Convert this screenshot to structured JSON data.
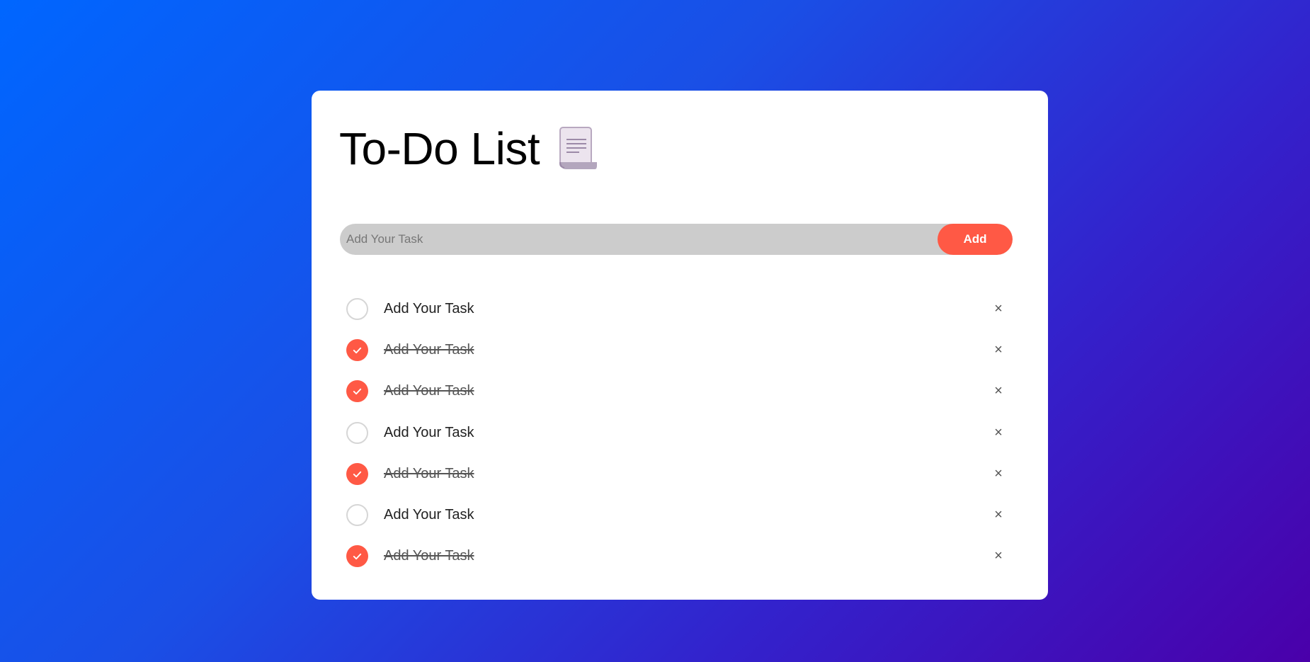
{
  "app": {
    "title": "To-Do List",
    "title_icon": "scroll-document-icon"
  },
  "input": {
    "placeholder": "Add Your Task",
    "value": ""
  },
  "add_button": {
    "label": "Add"
  },
  "colors": {
    "accent": "#ff5945",
    "input_background": "#cccccc",
    "card": "#ffffff"
  },
  "tasks": [
    {
      "text": "Add Your Task",
      "checked": false
    },
    {
      "text": "Add Your Task",
      "checked": true
    },
    {
      "text": "Add Your Task",
      "checked": true
    },
    {
      "text": "Add Your Task",
      "checked": false
    },
    {
      "text": "Add Your Task",
      "checked": true
    },
    {
      "text": "Add Your Task",
      "checked": false
    },
    {
      "text": "Add Your Task",
      "checked": true
    }
  ],
  "delete_glyph": "×"
}
